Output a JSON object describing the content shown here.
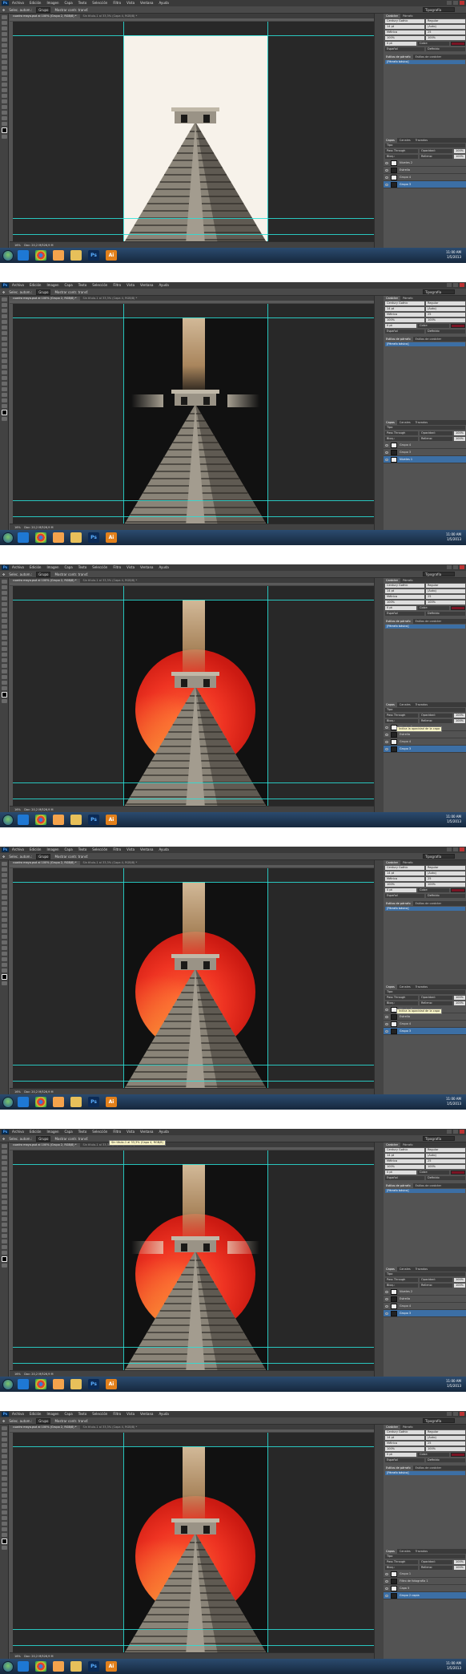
{
  "app": {
    "logo": "Ps",
    "menus": [
      "Archivo",
      "Edición",
      "Imagen",
      "Capa",
      "Texto",
      "Selección",
      "Filtro",
      "Vista",
      "Ventana",
      "Ayuda"
    ],
    "options": {
      "auto_select_label": "Selec. autom.:",
      "auto_select_value": "Grupo",
      "transform_label": "Mostrar contr. transf."
    },
    "workspace": "Tipografía",
    "doc_tab_1": "cuadro mayo.psd al 100% (Grupo 2, RGB/8) *",
    "doc_tab_2": "Sin título-1 al 33,3% (Capa 4, RGB/8) *",
    "status_zoom": "16%",
    "status_doc": "Doc: 20,2 M/526,9 M",
    "tooltip_opacity": "Indica la opacidad de la capa",
    "tooltip_doc": "Sin título-1 al 33,3% (Capa 4, RGB/8)"
  },
  "character_panel": {
    "tabs": [
      "Carácter",
      "Párrafo"
    ],
    "font": "Century Gothic",
    "style": "Regular",
    "size": "14 pt",
    "leading": "(Auto)",
    "kerning": "Métrica",
    "tracking": "25",
    "vscale": "100%",
    "hscale": "100%",
    "baseline": "0 pt",
    "color_label": "Color:",
    "lang": "Español",
    "aa": "Definido",
    "color": "#7a1424"
  },
  "styles_panel": {
    "tabs": [
      "Estilos de párrafo",
      "Estilos de carácter"
    ],
    "item": "[Párrafo básico]"
  },
  "layers_panel": {
    "tabs": [
      "Capas",
      "Canales",
      "Trazados"
    ],
    "kind": "Tipo",
    "blend": "Pass Through",
    "opacity_label": "Opacidad:",
    "opacity": "100%",
    "fill_label": "Relleno:",
    "fill": "100%",
    "lock_label": "Bloq.:",
    "frames": [
      [
        "Niveles 2",
        "Estrella",
        "Grupo 4",
        "Grupo 3"
      ],
      [
        "Grupo 4",
        "Grupo 3",
        "Niveles 1"
      ],
      [
        "Niveles 2",
        "Estrella",
        "Grupo 4",
        "Grupo 3"
      ],
      [
        "Niveles 2",
        "Estrella",
        "Grupo 4",
        "Grupo 3"
      ],
      [
        "Niveles 2",
        "Estrella",
        "Grupo 4",
        "Grupo 3"
      ],
      [
        "Grupo 1",
        "Filtro de fotografía 1",
        "Capa 5",
        "Grupo 2 copia"
      ]
    ]
  },
  "taskbar": {
    "time": "11:00 AM",
    "date": "1/5/2013"
  }
}
